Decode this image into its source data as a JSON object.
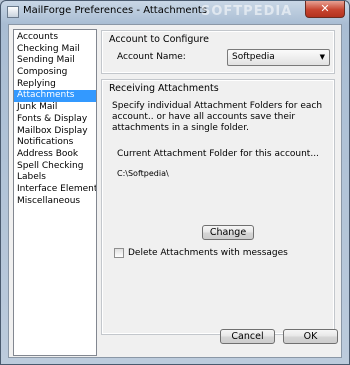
{
  "window": {
    "title": "MailForge Preferences - Attachments",
    "watermark": "SOFTPEDIA",
    "close_glyph": "✕"
  },
  "sidebar": {
    "items": [
      {
        "label": "Accounts",
        "selected": false
      },
      {
        "label": "Checking Mail",
        "selected": false
      },
      {
        "label": "Sending Mail",
        "selected": false
      },
      {
        "label": "Composing",
        "selected": false
      },
      {
        "label": "Replying",
        "selected": false
      },
      {
        "label": "Attachments",
        "selected": true
      },
      {
        "label": "Junk Mail",
        "selected": false
      },
      {
        "label": "Fonts & Display",
        "selected": false
      },
      {
        "label": "Mailbox Display",
        "selected": false
      },
      {
        "label": "Notifications",
        "selected": false
      },
      {
        "label": "Address Book",
        "selected": false
      },
      {
        "label": "Spell Checking",
        "selected": false
      },
      {
        "label": "Labels",
        "selected": false
      },
      {
        "label": "Interface Elements",
        "selected": false
      },
      {
        "label": "Miscellaneous",
        "selected": false
      }
    ]
  },
  "account_group": {
    "title": "Account to Configure",
    "account_label": "Account Name:",
    "account_value": "Softpedia",
    "arrow_glyph": "▼"
  },
  "attachments_group": {
    "title": "Receiving Attachments",
    "description": "Specify individual Attachment Folders for each account.. or have all accounts save their attachments in a single folder.",
    "current_label": "Current Attachment Folder for this account...",
    "current_path": "C:\\Softpedia\\",
    "change_label": "Change",
    "delete_label": "Delete Attachments with messages",
    "delete_checked": false
  },
  "footer": {
    "cancel_label": "Cancel",
    "ok_label": "OK"
  }
}
